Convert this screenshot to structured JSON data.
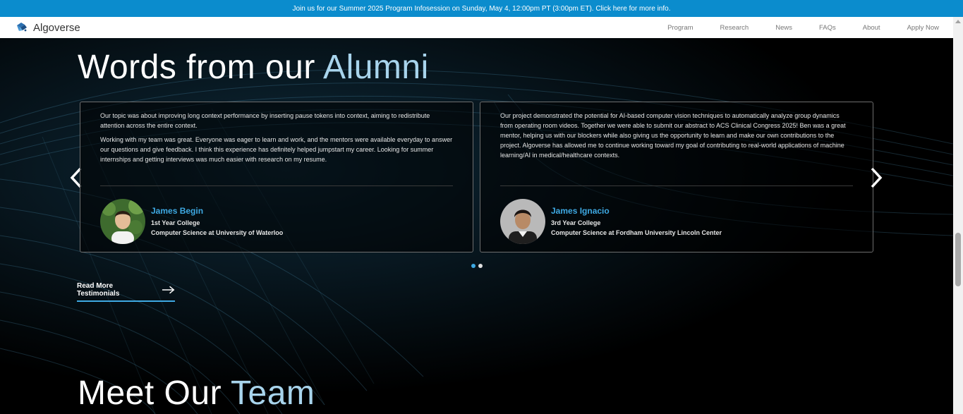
{
  "banner": {
    "text": "Join us for our Summer 2025 Program Infosession on Sunday, May 4, 12:00pm PT (3:00pm ET). Click here for more info."
  },
  "nav": {
    "logo_text": "Algoverse",
    "links": [
      "Program",
      "Research",
      "News",
      "FAQs",
      "About",
      "Apply Now"
    ]
  },
  "testimonials": {
    "title_main": "Words from our ",
    "title_accent": "Alumni",
    "cards": [
      {
        "paragraphs": [
          "Our topic was about improving long context performance by inserting pause tokens into context, aiming to redistribute attention across the entire context.",
          "Working with my team was great. Everyone was eager to learn and work, and the mentors were available everyday to answer our questions and give feedback. I think this experience has definitely helped jumpstart my career. Looking for summer internships and getting interviews was much easier with research on my resume."
        ],
        "name": "James Begin",
        "year": "1st Year College",
        "school": "Computer Science at University of Waterloo"
      },
      {
        "paragraphs": [
          "Our project demonstrated the potential for AI-based computer vision techniques to automatically analyze group dynamics from operating room videos. Together we were able to submit our abstract to ACS Clinical Congress 2025! Ben was a great mentor, helping us with our blockers while also giving us the opportunity to learn and make our own contributions to the project. Algoverse has allowed me to continue working toward my goal of contributing to real-world applications of machine learning/AI in medical/healthcare contexts."
        ],
        "name": "James Ignacio",
        "year": "3rd Year College",
        "school": "Computer Science at Fordham University Lincoln Center"
      }
    ],
    "read_more_label": "Read More Testimonials",
    "pagination": {
      "active_index": 0,
      "count": 2
    }
  },
  "team": {
    "title_main": "Meet Our ",
    "title_accent": "Team"
  },
  "colors": {
    "banner": "#0b8ccd",
    "accent": "#3ea9e3",
    "title_accent": "#a8d4ec",
    "background": "#000000"
  }
}
